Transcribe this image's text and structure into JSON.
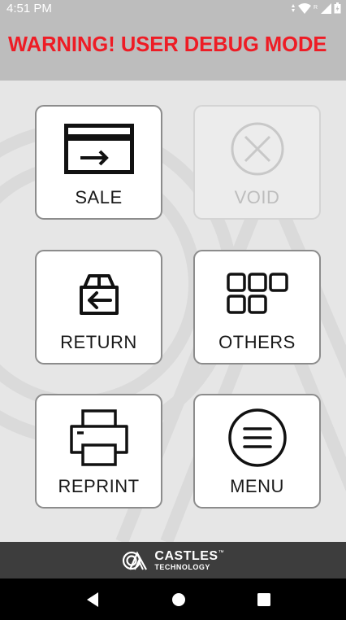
{
  "status_bar": {
    "time": "4:51 PM",
    "icons": [
      "data-arrow-icon",
      "wifi-icon",
      "roaming-r-icon",
      "cell-signal-icon",
      "battery-icon"
    ]
  },
  "header": {
    "warning": "WARNING! USER DEBUG MODE",
    "warning_color": "#ee1c25"
  },
  "tiles": [
    {
      "label": "SALE",
      "icon": "card-swipe-icon",
      "enabled": true
    },
    {
      "label": "VOID",
      "icon": "void-x-circle-icon",
      "enabled": false
    },
    {
      "label": "RETURN",
      "icon": "return-box-icon",
      "enabled": true
    },
    {
      "label": "OTHERS",
      "icon": "grid-squares-icon",
      "enabled": true
    },
    {
      "label": "REPRINT",
      "icon": "printer-icon",
      "enabled": true
    },
    {
      "label": "MENU",
      "icon": "menu-circle-icon",
      "enabled": true
    }
  ],
  "footer": {
    "brand_name": "CASTLES",
    "brand_tm": "™",
    "brand_sub": "TECHNOLOGY",
    "icon": "castles-logo-icon"
  },
  "nav_bar": {
    "buttons": [
      "back-icon",
      "home-icon",
      "recents-icon"
    ]
  },
  "colors": {
    "header_bg": "#bdbdbd",
    "main_bg": "#e6e6e6",
    "footer_bg": "#3d3d3d",
    "nav_bg": "#000000"
  }
}
